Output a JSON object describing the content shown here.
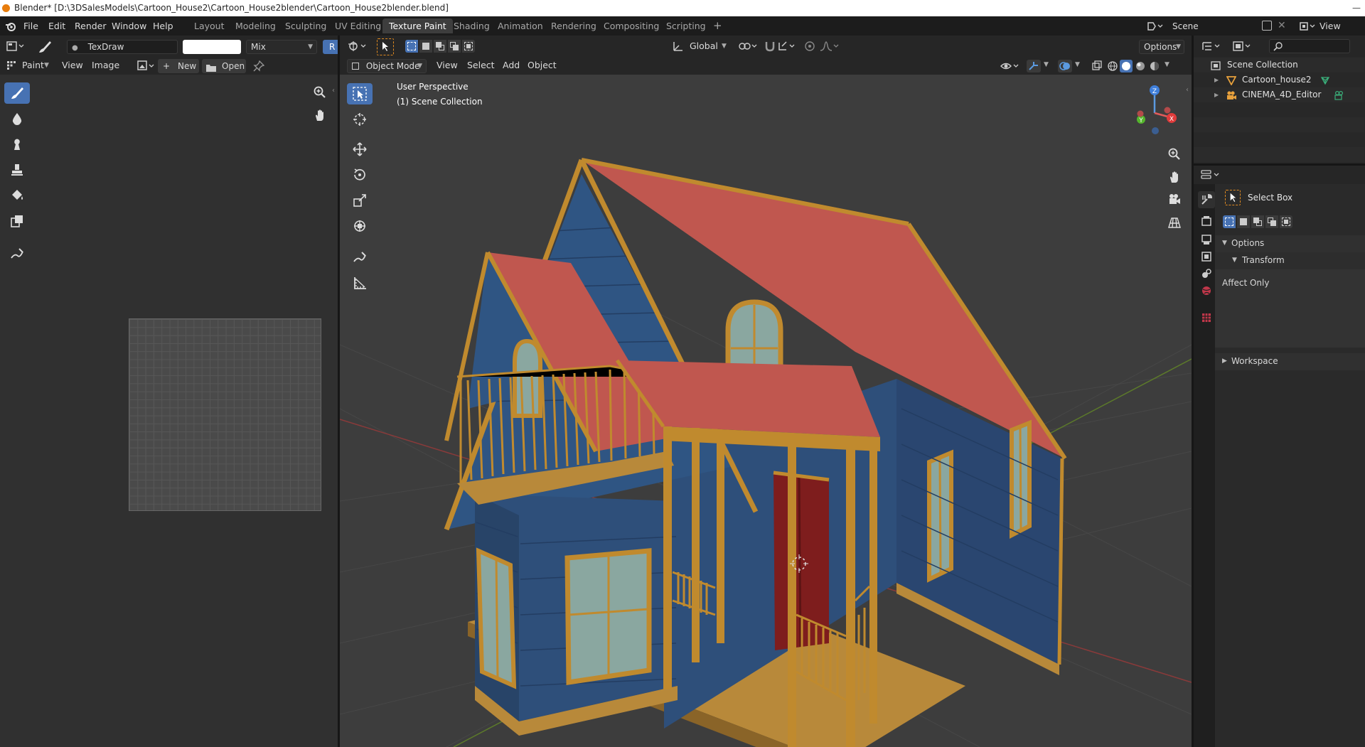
{
  "window": {
    "title": "Blender* [D:\\3DSalesModels\\Cartoon_House2\\Cartoon_House2blender\\Cartoon_House2blender.blend]",
    "minimize": "—"
  },
  "menu": [
    "File",
    "Edit",
    "Render",
    "Window",
    "Help"
  ],
  "workspaces": [
    {
      "label": "Layout",
      "active": false
    },
    {
      "label": "Modeling",
      "active": false
    },
    {
      "label": "Sculpting",
      "active": false
    },
    {
      "label": "UV Editing",
      "active": false
    },
    {
      "label": "Texture Paint",
      "active": true
    },
    {
      "label": "Shading",
      "active": false
    },
    {
      "label": "Animation",
      "active": false
    },
    {
      "label": "Rendering",
      "active": false
    },
    {
      "label": "Compositing",
      "active": false
    },
    {
      "label": "Scripting",
      "active": false
    }
  ],
  "add_workspace": "+",
  "scene": {
    "name": "Scene",
    "view_layer": "View Layer"
  },
  "image_editor": {
    "brush_name": "TexDraw",
    "blend_mode": "Mix",
    "radius_label": "R",
    "mode": "Paint",
    "view": "View",
    "image": "Image",
    "new": "New",
    "open": "Open"
  },
  "viewport": {
    "orientation": "Global",
    "options": "Options",
    "mode": "Object Mode",
    "view": "View",
    "select": "Select",
    "add": "Add",
    "object": "Object",
    "overlay_line1": "User Perspective",
    "overlay_line2": "(1) Scene Collection",
    "gizmo_z": "Z",
    "gizmo_x": "X",
    "gizmo_y": "Y"
  },
  "outliner": {
    "root": "Scene Collection",
    "items": [
      "Cartoon_house2",
      "CINEMA_4D_Editor"
    ]
  },
  "properties": {
    "tool_name": "Select Box",
    "options": "Options",
    "transform": "Transform",
    "affect_only": "Affect Only",
    "workspace": "Workspace"
  },
  "colors": {
    "accent": "#4772b3",
    "house_wall": "#2e4f7a",
    "roof": "#c0574f",
    "trim": "#c08a2e",
    "door": "#7e1d1d"
  }
}
